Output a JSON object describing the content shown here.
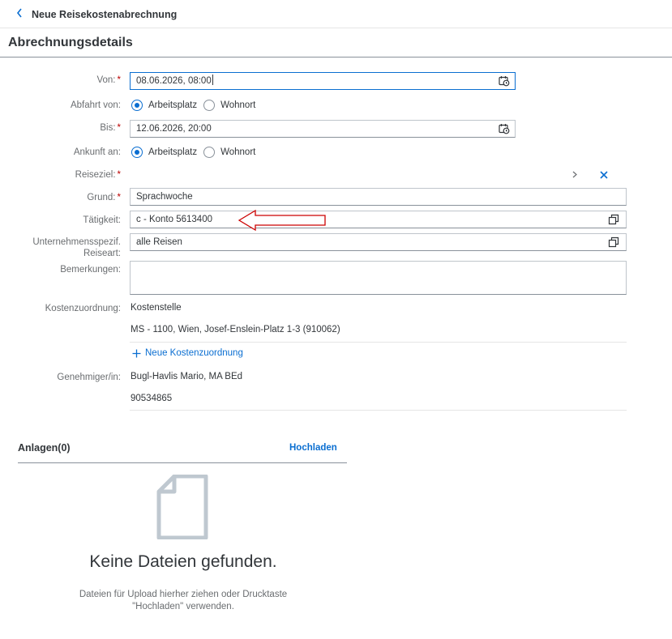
{
  "header": {
    "back_icon": "chevron-left-icon",
    "title": "Neue Reisekostenabrechnung"
  },
  "section": {
    "title": "Abrechnungsdetails"
  },
  "form": {
    "von": {
      "label": "Von:",
      "value": "08.06.2026, 08:00"
    },
    "abfahrt": {
      "label": "Abfahrt von:",
      "options": [
        "Arbeitsplatz",
        "Wohnort"
      ],
      "selected": "Arbeitsplatz"
    },
    "bis": {
      "label": "Bis:",
      "value": "12.06.2026, 20:00"
    },
    "ankunft": {
      "label": "Ankunft an:",
      "options": [
        "Arbeitsplatz",
        "Wohnort"
      ],
      "selected": "Arbeitsplatz"
    },
    "reiseziel": {
      "label": "Reiseziel:"
    },
    "grund": {
      "label": "Grund:",
      "value": "Sprachwoche"
    },
    "taetigkeit": {
      "label": "Tätigkeit:",
      "value": "c - Konto 5613400"
    },
    "reiseart": {
      "label_line1": "Unternehmensspezif.",
      "label_line2": "Reiseart:",
      "value": "alle Reisen"
    },
    "bemerkungen": {
      "label": "Bemerkungen:",
      "value": ""
    },
    "kosten": {
      "label": "Kostenzuordnung:",
      "type": "Kostenstelle",
      "detail": "MS - 1100, Wien, Josef-Enslein-Platz 1-3 (910062)",
      "add_link": "Neue Kostenzuordnung"
    },
    "genehmiger": {
      "label": "Genehmiger/in:",
      "name": "Bugl-Havlis Mario, MA BEd",
      "id": "90534865"
    }
  },
  "attachments": {
    "title": "Anlagen(0)",
    "upload_label": "Hochladen",
    "empty_title": "Keine Dateien gefunden.",
    "empty_desc_line1": "Dateien für Upload hierher ziehen oder Drucktaste",
    "empty_desc_line2": "\"Hochladen\" verwenden."
  },
  "colors": {
    "accent": "#0a6ed1",
    "required": "#bb0000",
    "annotation_arrow": "#cc0000"
  }
}
